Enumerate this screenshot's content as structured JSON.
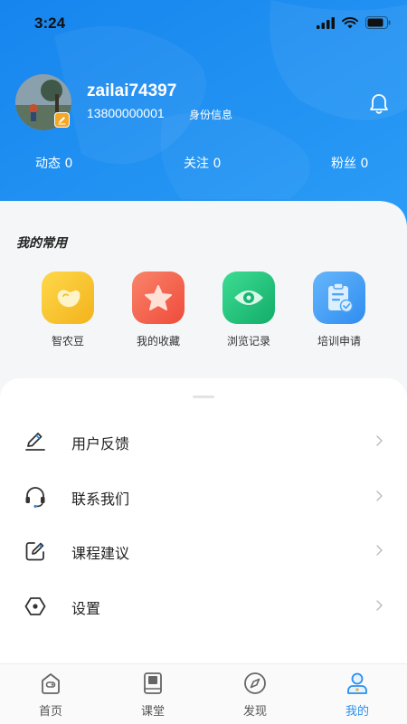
{
  "status": {
    "time": "3:24"
  },
  "profile": {
    "username": "zailai74397",
    "phone": "13800000001",
    "id_info": "身份信息"
  },
  "stats": [
    {
      "label": "动态 0"
    },
    {
      "label": "关注 0"
    },
    {
      "label": "粉丝 0"
    }
  ],
  "common": {
    "title": "我的常用",
    "items": [
      {
        "label": "智农豆",
        "icon": "bean-icon",
        "color": "#f7c428"
      },
      {
        "label": "我的收藏",
        "icon": "star-icon",
        "color": "#f2634a"
      },
      {
        "label": "浏览记录",
        "icon": "eye-icon",
        "color": "#20c07a"
      },
      {
        "label": "培训申请",
        "icon": "clipboard-icon",
        "color": "#3d9ef5"
      }
    ]
  },
  "menu": [
    {
      "label": "用户反馈",
      "icon": "pen-icon"
    },
    {
      "label": "联系我们",
      "icon": "headset-icon"
    },
    {
      "label": "课程建议",
      "icon": "edit-note-icon"
    },
    {
      "label": "设置",
      "icon": "settings-hexagon-icon"
    }
  ],
  "tabs": [
    {
      "label": "首页",
      "icon": "home-icon"
    },
    {
      "label": "课堂",
      "icon": "book-icon"
    },
    {
      "label": "发现",
      "icon": "compass-icon"
    },
    {
      "label": "我的",
      "icon": "user-icon",
      "active": true
    }
  ],
  "colors": {
    "brand_blue": "#1e8ff0",
    "active_tab": "#2a8ff0"
  }
}
